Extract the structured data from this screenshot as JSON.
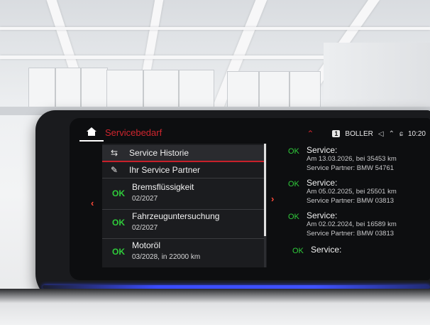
{
  "header": {
    "title": "Servicebedarf",
    "status_text": "BOLLER",
    "badge": "1",
    "time": "10:20",
    "icons": [
      "home-icon",
      "chevron-up-icon",
      "volume-icon",
      "signal-icon",
      "connectivity-icon"
    ]
  },
  "menu": [
    {
      "label": "Service Historie",
      "icon": "car-service-icon"
    },
    {
      "label": "Ihr Service Partner",
      "icon": "wrench-icon"
    }
  ],
  "services": [
    {
      "status": "OK",
      "name": "Bremsflüssigkeit",
      "due": "02/2027"
    },
    {
      "status": "OK",
      "name": "Fahrzeuguntersuchung",
      "due": "02/2027"
    },
    {
      "status": "OK",
      "name": "Motoröl",
      "due": "03/2028, in 22000 km"
    }
  ],
  "history": [
    {
      "status": "OK",
      "title": "Service:",
      "date": "Am 13.03.2026, bei 35453 km",
      "partner": "Service Partner: BMW 54761"
    },
    {
      "status": "OK",
      "title": "Service:",
      "date": "Am 05.02.2025, bei 25501 km",
      "partner": "Service Partner: BMW 03813"
    },
    {
      "status": "OK",
      "title": "Service:",
      "date": "Am 02.02.2024, bei 16589 km",
      "partner": "Service Partner: BMW 03813"
    },
    {
      "status": "OK",
      "title": "Service:"
    }
  ],
  "nav": {
    "left_arrow": "‹",
    "right_arrow": "›"
  },
  "colors": {
    "accent_red": "#d0262e",
    "ok_green": "#2fcc3b",
    "ambient_blue": "#3a4cff"
  }
}
